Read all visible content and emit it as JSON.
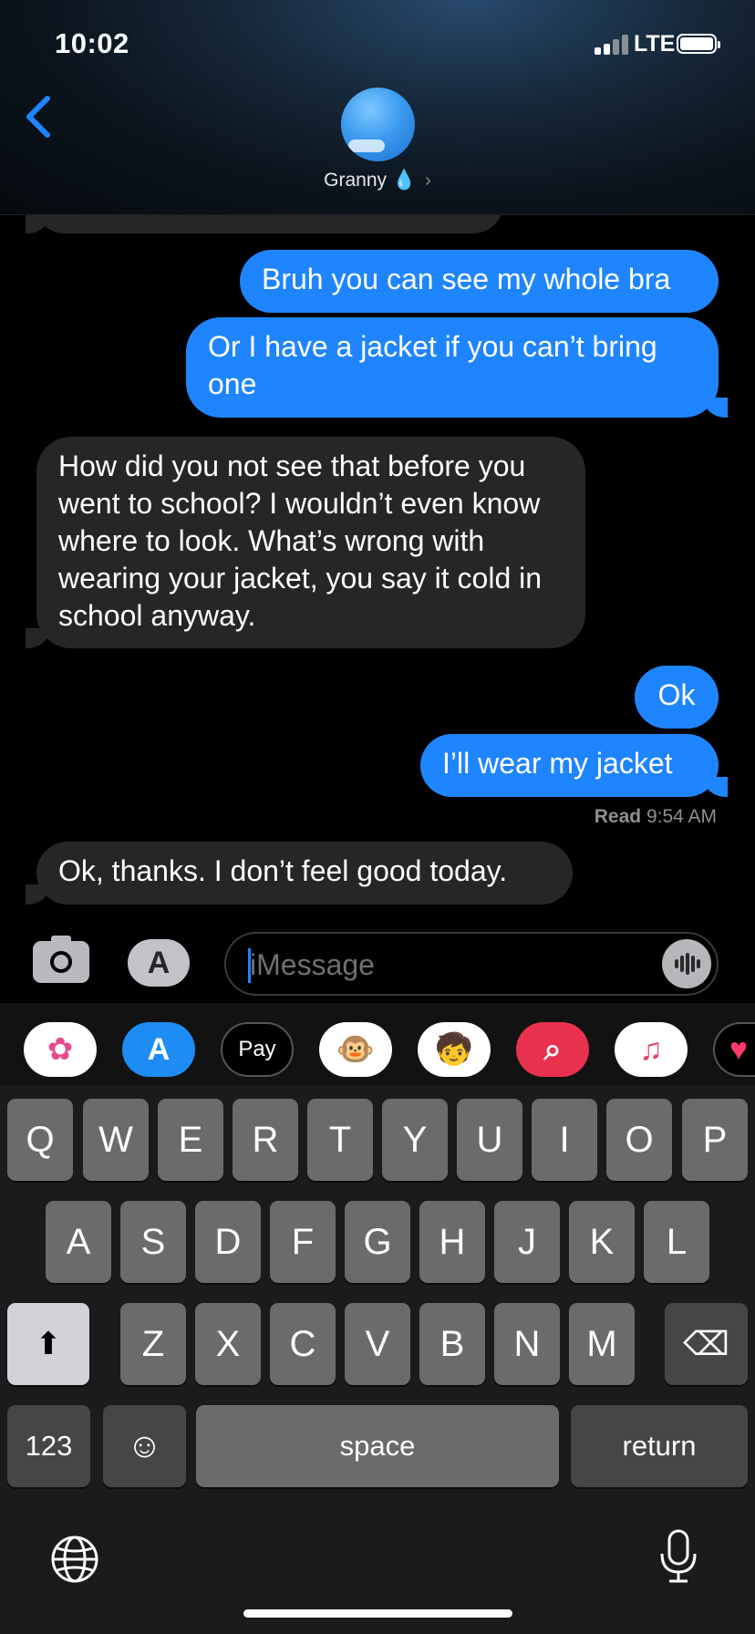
{
  "status_bar": {
    "time": "10:02",
    "network": "LTE"
  },
  "header": {
    "contact_name": "Granny",
    "contact_emoji": "💧",
    "chevron": "›"
  },
  "messages": [
    {
      "from": "me",
      "text": "Bruh you can see my whole bra"
    },
    {
      "from": "me",
      "text": "Or I have a jacket if you can’t bring one"
    },
    {
      "from": "them",
      "text": "How did you not see that before you went to school?  I wouldn’t even know where to look.  What’s wrong with wearing your jacket, you say it cold in school anyway."
    },
    {
      "from": "me",
      "text": "Ok"
    },
    {
      "from": "me",
      "text": "I’ll wear my jacket"
    },
    {
      "from": "them",
      "text": "Ok, thanks.  I don’t feel good today."
    }
  ],
  "read_receipt": {
    "label": "Read",
    "time": "9:54 AM"
  },
  "composer": {
    "placeholder": "iMessage"
  },
  "app_strip": [
    {
      "name": "photos",
      "glyph": "✿"
    },
    {
      "name": "app-store",
      "glyph": "A"
    },
    {
      "name": "apple-pay",
      "glyph": "Pay"
    },
    {
      "name": "animoji",
      "glyph": "🐵"
    },
    {
      "name": "memoji",
      "glyph": "🧒"
    },
    {
      "name": "web-images",
      "glyph": "⌕"
    },
    {
      "name": "music",
      "glyph": "♫"
    },
    {
      "name": "digital-touch",
      "glyph": "♥"
    }
  ],
  "keyboard": {
    "row1": [
      "Q",
      "W",
      "E",
      "R",
      "T",
      "Y",
      "U",
      "I",
      "O",
      "P"
    ],
    "row2": [
      "A",
      "S",
      "D",
      "F",
      "G",
      "H",
      "J",
      "K",
      "L"
    ],
    "row3": [
      "Z",
      "X",
      "C",
      "V",
      "B",
      "N",
      "M"
    ],
    "numbers_label": "123",
    "space_label": "space",
    "return_label": "return",
    "shift_glyph": "⬆",
    "emoji_glyph": "☺",
    "delete_glyph": "⌫"
  },
  "colors": {
    "sent_bubble": "#1f85ff",
    "received_bubble": "#262628",
    "background": "#000000"
  }
}
